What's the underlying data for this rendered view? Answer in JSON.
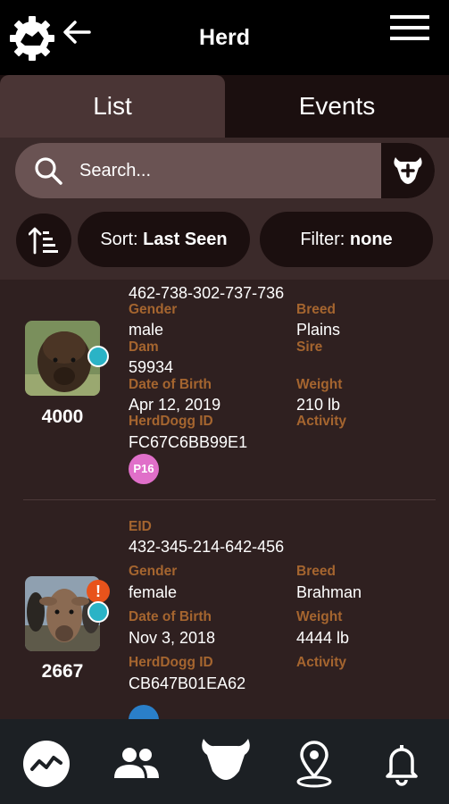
{
  "header": {
    "title": "Herd",
    "icons": [
      "herddogg-gear-logo-icon",
      "back-arrow-icon",
      "hamburger-menu-icon"
    ]
  },
  "tabs": [
    {
      "label": "List",
      "active": true
    },
    {
      "label": "Events",
      "active": false
    }
  ],
  "search": {
    "placeholder": "Search...",
    "value": "",
    "add_icon": "add-bison-icon"
  },
  "sort": {
    "icon": "sort-ascending-icon",
    "prefix": "Sort:",
    "value": "Last Seen"
  },
  "filter": {
    "prefix": "Filter:",
    "value": "none"
  },
  "animals": [
    {
      "tag_number": "4000",
      "eid": "462-738-302-737-736",
      "labels": {
        "gender": "Gender",
        "breed": "Breed",
        "dam": "Dam",
        "sire": "Sire",
        "dob": "Date of Birth",
        "weight": "Weight",
        "herddogg_id": "HerdDogg ID",
        "activity": "Activity"
      },
      "gender": "male",
      "breed": "Plains",
      "dam": "59934",
      "dob": "Apr 12, 2019",
      "weight": "210 lb",
      "herddogg_id": "FC67C6BB99E1",
      "badge": "P16",
      "badge_color": "#e06fc9",
      "status_color": "#2ab3c6"
    },
    {
      "tag_number": "2667",
      "eid_label": "EID",
      "eid": "432-345-214-642-456",
      "labels": {
        "gender": "Gender",
        "breed": "Breed",
        "dob": "Date of Birth",
        "weight": "Weight",
        "herddogg_id": "HerdDogg ID",
        "activity": "Activity"
      },
      "gender": "female",
      "breed": "Brahman",
      "dob": "Nov 3, 2018",
      "weight": "4444 lb",
      "herddogg_id": "CB647B01EA62",
      "alert": "!",
      "alert_color": "#e8531b",
      "status_color": "#2ab3c6",
      "badge_color": "#2a7fc9"
    }
  ],
  "bottom_nav": [
    "activity-chart-icon",
    "people-icon",
    "bison-icon",
    "location-pin-icon",
    "bell-icon"
  ],
  "colors": {
    "label_accent": "#a5652f",
    "panel": "#3b2a2a",
    "list_bg": "#2f2020",
    "nav_bg": "#1c2024"
  }
}
